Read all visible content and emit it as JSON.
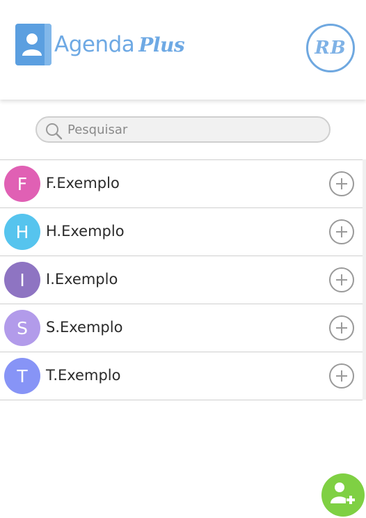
{
  "header": {
    "logo_text": "Agenda",
    "logo_suffix": "Plus",
    "user_initials": "RB",
    "colors": {
      "brand": "#5b9fe0",
      "brand_light": "#6ea9e4"
    }
  },
  "search": {
    "placeholder": "Pesquisar",
    "value": "",
    "icon": "search-icon"
  },
  "contacts": [
    {
      "initial": "F",
      "name": "F.Exemplo",
      "color": "#e060b4",
      "action_icon": "plus-circle-icon"
    },
    {
      "initial": "H",
      "name": "H.Exemplo",
      "color": "#56c4ee",
      "action_icon": "plus-circle-icon"
    },
    {
      "initial": "I",
      "name": "I.Exemplo",
      "color": "#8e74c2",
      "action_icon": "plus-circle-icon"
    },
    {
      "initial": "S",
      "name": "S.Exemplo",
      "color": "#b29bea",
      "action_icon": "plus-circle-icon"
    },
    {
      "initial": "T",
      "name": "T.Exemplo",
      "color": "#8794f6",
      "action_icon": "plus-circle-icon"
    }
  ],
  "fab": {
    "icon": "add-user-icon",
    "color": "#7fd043"
  }
}
